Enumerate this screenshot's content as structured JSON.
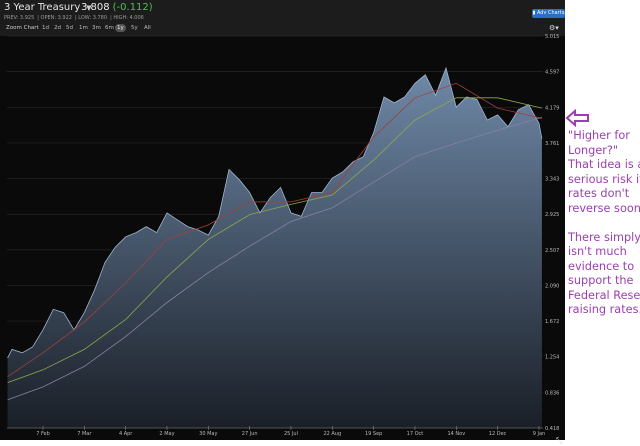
{
  "header": {
    "title": "3 Year Treasury",
    "price": "3.808",
    "change": "(-0.112)",
    "stats": [
      "PREV: 3.925",
      "OPEN: 3.922",
      "LOW: 3.780",
      "HIGH: 4.006"
    ],
    "adv_charts_label": "Adv Charts"
  },
  "toolbar": {
    "zoom_label": "Zoom Chart",
    "ranges": [
      "1d",
      "2d",
      "5d",
      "1m",
      "3m",
      "6m",
      "1y",
      "5y",
      "All"
    ],
    "selected": "1y"
  },
  "colors": {
    "change_negative": "#4cc04c",
    "area_top": "#6f89a8",
    "area_bottom": "#1a1f27",
    "ma_red": "#a0413a",
    "ma_green": "#8fa84a",
    "ma_purple": "#8a7fa6",
    "annotation": "#9b3fb0",
    "adv_button": "#2a6fc4"
  },
  "chart_data": {
    "type": "area",
    "title": "",
    "xlabel": "",
    "ylabel": "",
    "ylim": [
      0.418,
      5.015
    ],
    "y_ticks": [
      "5.015",
      "4.597",
      "4.179",
      "3.761",
      "3.343",
      "2.925",
      "2.507",
      "2.090",
      "1.672",
      "1.254",
      "0.836",
      "0.418"
    ],
    "x_ticks": [
      "7 Feb",
      "7 Mar",
      "4 Apr",
      "2 May",
      "30 May",
      "27 Jun",
      "25 Jul",
      "22 Aug",
      "19 Sep",
      "17 Oct",
      "14 Nov",
      "12 Dec",
      "9 Jan"
    ],
    "grid": true,
    "y_axis_position": "right",
    "series": [
      {
        "dates": [
          "14 Jan",
          "17 Jan",
          "24 Jan",
          "31 Jan",
          "7 Feb",
          "14 Feb",
          "21 Feb",
          "28 Feb",
          "7 Mar",
          "14 Mar",
          "21 Mar",
          "28 Mar",
          "4 Apr",
          "11 Apr",
          "18 Apr",
          "25 Apr",
          "2 May",
          "9 May",
          "16 May",
          "23 May",
          "30 May",
          "6 Jun",
          "13 Jun",
          "20 Jun",
          "27 Jun",
          "4 Jul",
          "11 Jul",
          "18 Jul",
          "25 Jul",
          "1 Aug",
          "8 Aug",
          "15 Aug",
          "22 Aug",
          "29 Aug",
          "5 Sep",
          "12 Sep",
          "19 Sep",
          "26 Sep",
          "3 Oct",
          "10 Oct",
          "17 Oct",
          "24 Oct",
          "31 Oct",
          "7 Nov",
          "14 Nov",
          "21 Nov",
          "28 Nov",
          "5 Dec",
          "12 Dec",
          "19 Dec",
          "26 Dec",
          "2 Jan",
          "9 Jan",
          "11 Jan"
        ],
        "values": [
          1.24,
          1.34,
          1.3,
          1.37,
          1.57,
          1.81,
          1.77,
          1.57,
          1.77,
          2.04,
          2.36,
          2.54,
          2.66,
          2.71,
          2.78,
          2.71,
          2.94,
          2.86,
          2.78,
          2.74,
          2.68,
          2.9,
          3.45,
          3.33,
          3.18,
          2.94,
          3.12,
          3.24,
          2.94,
          2.9,
          3.18,
          3.18,
          3.35,
          3.42,
          3.54,
          3.6,
          3.88,
          4.3,
          4.23,
          4.3,
          4.46,
          4.56,
          4.32,
          4.64,
          4.18,
          4.3,
          4.27,
          4.03,
          4.09,
          3.95,
          4.15,
          4.21,
          3.99,
          3.81
        ]
      },
      {
        "dates": [
          "14 Jan",
          "7 Feb",
          "7 Mar",
          "4 Apr",
          "2 May",
          "30 May",
          "27 Jun",
          "25 Jul",
          "22 Aug",
          "19 Sep",
          "17 Oct",
          "14 Nov",
          "12 Dec",
          "11 Jan"
        ],
        "values": [
          1.02,
          1.3,
          1.66,
          2.12,
          2.63,
          2.8,
          3.07,
          3.07,
          3.18,
          3.83,
          4.29,
          4.46,
          4.17,
          4.05
        ],
        "color_key": "ma_red"
      },
      {
        "dates": [
          "14 Jan",
          "7 Feb",
          "7 Mar",
          "4 Apr",
          "2 May",
          "30 May",
          "27 Jun",
          "25 Jul",
          "22 Aug",
          "19 Sep",
          "17 Oct",
          "14 Nov",
          "12 Dec",
          "11 Jan"
        ],
        "values": [
          0.95,
          1.1,
          1.34,
          1.69,
          2.19,
          2.63,
          2.92,
          3.04,
          3.15,
          3.56,
          4.03,
          4.29,
          4.29,
          4.17
        ],
        "color_key": "ma_green"
      },
      {
        "dates": [
          "14 Jan",
          "7 Feb",
          "7 Mar",
          "4 Apr",
          "2 May",
          "30 May",
          "27 Jun",
          "25 Jul",
          "22 Aug",
          "19 Sep",
          "17 Oct",
          "14 Nov",
          "12 Dec",
          "11 Jan"
        ],
        "values": [
          0.75,
          0.9,
          1.14,
          1.49,
          1.89,
          2.24,
          2.55,
          2.84,
          3.0,
          3.3,
          3.6,
          3.76,
          3.91,
          4.06
        ],
        "color_key": "ma_purple"
      }
    ]
  },
  "annotation": {
    "lines": [
      "\"Higher for",
      "Longer?\"",
      "That idea is at",
      "serious risk if",
      "rates don't",
      "reverse soon.",
      "",
      "There simply",
      "isn't much",
      "evidence to",
      "support the",
      "Federal Reserve",
      "raising rates."
    ],
    "arrow_icon": "left-arrow-icon"
  }
}
